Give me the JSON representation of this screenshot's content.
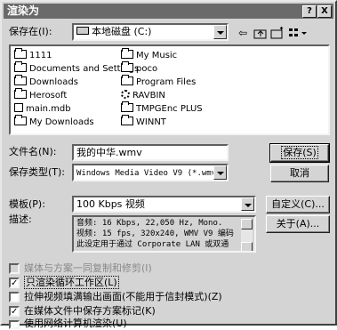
{
  "window": {
    "title": "渲染为",
    "help_button": "?",
    "close_button": "X"
  },
  "location": {
    "label": "保存在(I):",
    "value": "本地磁盘 (C:)"
  },
  "files": [
    {
      "name": "1111",
      "icon": "folder-icon"
    },
    {
      "name": "Documents and Settings",
      "icon": "folder-icon"
    },
    {
      "name": "Downloads",
      "icon": "folder-icon"
    },
    {
      "name": "Herosoft",
      "icon": "folder-icon"
    },
    {
      "name": "main.mdb",
      "icon": "file-icon"
    },
    {
      "name": "My Downloads",
      "icon": "globe-folder-icon"
    },
    {
      "name": "My Music",
      "icon": "folder-icon"
    },
    {
      "name": "poco",
      "icon": "folder-icon"
    },
    {
      "name": "Program Files",
      "icon": "folder-icon"
    },
    {
      "name": "RAVBIN",
      "icon": "gear-icon"
    },
    {
      "name": "TMPGEnc PLUS",
      "icon": "folder-icon"
    },
    {
      "name": "WINNT",
      "icon": "folder-icon"
    }
  ],
  "filename": {
    "label": "文件名(N):",
    "value": "我的中华.wmv"
  },
  "filetype": {
    "label": "保存类型(T):",
    "value": "Windows Media Video V9 (*.wmv)"
  },
  "template": {
    "label": "模板(P):",
    "value": "100 Kbps 视频"
  },
  "description": {
    "label": "描述:",
    "lines": [
      "音频: 16 Kbps, 22,050 Hz, Mono.",
      "视频: 15 fps, 320x240, WMV V9 编码",
      "此设定用于通过 Corporate LAN 或双通"
    ]
  },
  "buttons": {
    "save": "保存(S)",
    "cancel": "取消",
    "custom": "自定义(C)...",
    "about": "关于(A)..."
  },
  "options": [
    {
      "label": "媒体与方案一同复制和修剪(I)",
      "checked": false,
      "disabled": true
    },
    {
      "label": "只渲染循环工作区(L)",
      "checked": true,
      "disabled": false
    },
    {
      "label": "拉伸视频填满输出画面(不能用于信封模式)(Z)",
      "checked": false,
      "disabled": false
    },
    {
      "label": "在媒体文件中保存方案标记(K)",
      "checked": true,
      "disabled": false
    },
    {
      "label": "使用网络计算机渲染(U)",
      "checked": false,
      "disabled": false
    }
  ],
  "toolbar": {
    "back": "⇦",
    "up": "up-folder-icon",
    "new_folder": "new-folder-icon",
    "view_menu": "view-menu-icon"
  }
}
